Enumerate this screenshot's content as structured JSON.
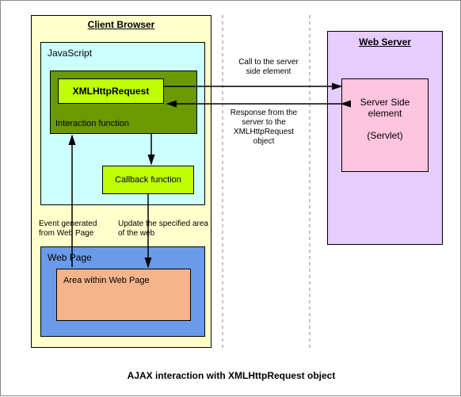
{
  "diagram": {
    "caption": "AJAX interaction with XMLHttpRequest object",
    "client_browser": {
      "title": "Client Browser",
      "javascript": {
        "title": "JavaScript",
        "xhr": "XMLHttpRequest",
        "interaction_fn": "Interaction function",
        "callback_fn": "Callback function"
      },
      "webpage": {
        "title": "Web Page",
        "area": "Area within Web Page"
      }
    },
    "web_server": {
      "title": "Web Server",
      "element_line1": "Server Side element",
      "element_line2": "(Servlet)"
    },
    "labels": {
      "call": "Call to the server side element",
      "response": "Response from the server to the XMLHttpRequest object",
      "event": "Event generated from Web Page",
      "update": "Update  the specified area of  the web"
    }
  },
  "chart_data": {
    "type": "diagram",
    "title": "AJAX interaction with XMLHttpRequest object",
    "nodes": [
      {
        "id": "client_browser",
        "label": "Client Browser",
        "parent": null
      },
      {
        "id": "javascript",
        "label": "JavaScript",
        "parent": "client_browser"
      },
      {
        "id": "interaction_fn",
        "label": "Interaction function",
        "parent": "javascript"
      },
      {
        "id": "xhr",
        "label": "XMLHttpRequest",
        "parent": "interaction_fn"
      },
      {
        "id": "callback_fn",
        "label": "Callback function",
        "parent": "javascript"
      },
      {
        "id": "web_page",
        "label": "Web Page",
        "parent": "client_browser"
      },
      {
        "id": "area",
        "label": "Area within Web Page",
        "parent": "web_page"
      },
      {
        "id": "web_server",
        "label": "Web Server",
        "parent": null
      },
      {
        "id": "server_element",
        "label": "Server Side element (Servlet)",
        "parent": "web_server"
      }
    ],
    "edges": [
      {
        "from": "xhr",
        "to": "server_element",
        "label": "Call to the server side element",
        "dir": "forward"
      },
      {
        "from": "server_element",
        "to": "xhr",
        "label": "Response from the server to the XMLHttpRequest object",
        "dir": "forward"
      },
      {
        "from": "area",
        "to": "interaction_fn",
        "label": "Event generated from Web Page",
        "dir": "forward"
      },
      {
        "from": "interaction_fn",
        "to": "callback_fn",
        "label": "",
        "dir": "forward"
      },
      {
        "from": "callback_fn",
        "to": "area",
        "label": "Update the specified area of the web",
        "dir": "forward"
      }
    ]
  }
}
